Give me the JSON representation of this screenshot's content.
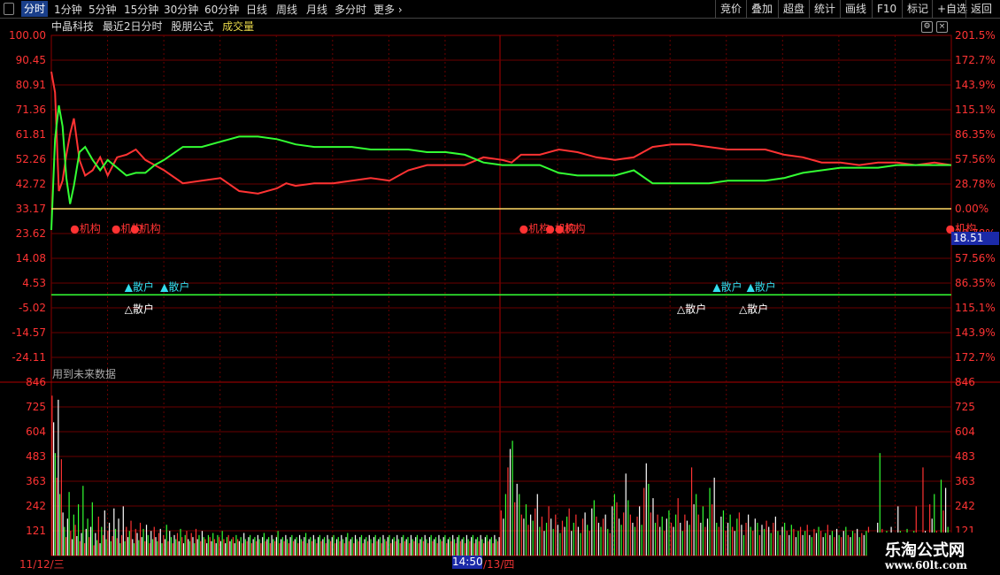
{
  "toolbar": {
    "tabs": [
      "分时",
      "1分钟",
      "5分钟",
      "15分钟",
      "30分钟",
      "60分钟",
      "日线",
      "周线",
      "月线",
      "多分时",
      "更多"
    ],
    "right_buttons": [
      "竞价",
      "叠加",
      "超盘",
      "统计",
      "画线",
      "F10",
      "标记",
      "+自选",
      "返回"
    ]
  },
  "title": {
    "stock_name": "中晶科技",
    "period": "最近2日分时",
    "formula": "股朋公式",
    "indicator": "成交量"
  },
  "colors": {
    "up": "#ff3333",
    "down": "#33ff33",
    "grid": "#8b0000",
    "axis_text": "#ff3333",
    "accent_blue": "#1b2aa8",
    "yellow": "#ffd966",
    "cyan": "#33ddee"
  },
  "chart_data": [
    {
      "type": "line",
      "name": "main_panel",
      "y_left_ticks": [
        "100.00",
        "90.45",
        "80.91",
        "71.36",
        "61.81",
        "52.26",
        "42.72",
        "33.17",
        "23.62",
        "14.08",
        "4.53",
        "-5.02",
        "-14.57",
        "-24.11"
      ],
      "y_right_ticks": [
        "201.5%",
        "172.7%",
        "143.9%",
        "115.1%",
        "86.35%",
        "57.56%",
        "28.78%",
        "0.00%",
        "28.78%",
        "57.56%",
        "86.35%",
        "115.1%",
        "143.9%",
        "172.7%"
      ],
      "ylim": [
        -24.11,
        100.0
      ],
      "x_sessions": [
        "11/12/三",
        "11/13/四"
      ],
      "series": [
        {
          "color": "red",
          "x": [
            0,
            2,
            4,
            6,
            8,
            10,
            12,
            15,
            18,
            22,
            26,
            30,
            35,
            40,
            45,
            50,
            55,
            60,
            70,
            80,
            90,
            100,
            110,
            120,
            125,
            130,
            140,
            150,
            160,
            170,
            180,
            190,
            200,
            210,
            220,
            230,
            240,
            245,
            250,
            260,
            270,
            280,
            290,
            300,
            310,
            320,
            330,
            340,
            350,
            360,
            370,
            380,
            390,
            400,
            410,
            420,
            430,
            440,
            450,
            460,
            470,
            479
          ],
          "y": [
            86,
            78,
            40,
            44,
            54,
            62,
            68,
            52,
            46,
            48,
            53,
            46,
            53,
            54,
            56,
            52,
            50,
            48,
            43,
            44,
            45,
            40,
            39,
            41,
            43,
            42,
            43,
            43,
            44,
            45,
            44,
            48,
            50,
            50,
            50,
            53,
            52,
            51,
            54,
            54,
            56,
            55,
            53,
            52,
            53,
            57,
            58,
            58,
            57,
            56,
            56,
            56,
            54,
            53,
            51,
            51,
            50,
            51,
            51,
            50,
            51,
            50
          ]
        },
        {
          "color": "green",
          "x": [
            0,
            2,
            4,
            6,
            8,
            10,
            12,
            15,
            18,
            22,
            26,
            30,
            35,
            40,
            45,
            50,
            55,
            60,
            70,
            80,
            90,
            100,
            110,
            120,
            125,
            130,
            140,
            150,
            160,
            170,
            180,
            190,
            200,
            210,
            220,
            230,
            240,
            245,
            250,
            260,
            270,
            280,
            290,
            300,
            310,
            320,
            330,
            340,
            350,
            360,
            370,
            380,
            390,
            400,
            410,
            420,
            430,
            440,
            450,
            460,
            470,
            479
          ],
          "y": [
            25,
            60,
            73,
            65,
            45,
            35,
            42,
            55,
            57,
            52,
            48,
            52,
            49,
            46,
            47,
            47,
            50,
            52,
            57,
            57,
            59,
            61,
            61,
            60,
            59,
            58,
            57,
            57,
            57,
            56,
            56,
            56,
            55,
            55,
            54,
            51,
            50,
            50,
            50,
            50,
            47,
            46,
            46,
            46,
            48,
            43,
            43,
            43,
            43,
            44,
            44,
            44,
            45,
            47,
            48,
            49,
            49,
            49,
            50,
            50,
            50,
            50
          ]
        },
        {
          "color": "yellow",
          "x": [
            0,
            479
          ],
          "y": [
            33.17,
            33.17
          ]
        },
        {
          "color": "green",
          "x": [
            0,
            479
          ],
          "y": [
            0.0,
            0.0
          ]
        }
      ],
      "annotations": [
        {
          "text": "机构",
          "x": 10,
          "y": 25.5,
          "color": "red",
          "marker": "●"
        },
        {
          "text": "机构",
          "x": 32,
          "y": 25.5,
          "color": "red",
          "marker": "●"
        },
        {
          "text": "机构",
          "x": 42,
          "y": 25.5,
          "color": "red",
          "marker": "●"
        },
        {
          "text": "机构",
          "x": 249,
          "y": 25.5,
          "color": "red",
          "marker": "●"
        },
        {
          "text": "机构",
          "x": 263,
          "y": 25.5,
          "color": "red",
          "marker": "●"
        },
        {
          "text": "机构",
          "x": 268,
          "y": 25.5,
          "color": "red",
          "marker": "●"
        },
        {
          "text": "机构",
          "x": 476,
          "y": 25.5,
          "color": "red",
          "marker": "●"
        },
        {
          "text": "散户",
          "x": 39,
          "y": 3,
          "color": "cyan",
          "marker": "▲"
        },
        {
          "text": "散户",
          "x": 58,
          "y": 3,
          "color": "cyan",
          "marker": "▲"
        },
        {
          "text": "散户",
          "x": 352,
          "y": 3,
          "color": "cyan",
          "marker": "▲"
        },
        {
          "text": "散户",
          "x": 370,
          "y": 3,
          "color": "cyan",
          "marker": "▲"
        },
        {
          "text": "散户",
          "x": 39,
          "y": -5.5,
          "color": "white",
          "marker": "△"
        },
        {
          "text": "散户",
          "x": 333,
          "y": -5.5,
          "color": "white",
          "marker": "△"
        },
        {
          "text": "散户",
          "x": 366,
          "y": -5.5,
          "color": "white",
          "marker": "△"
        }
      ],
      "price_tag": "18.51"
    },
    {
      "type": "bar",
      "name": "volume_panel",
      "y_ticks": [
        "846",
        "725",
        "604",
        "483",
        "363",
        "242",
        "121"
      ],
      "ylim": [
        0,
        846
      ],
      "notice": "用到未来数据",
      "colors_cycle": [
        "red",
        "green",
        "white"
      ],
      "values": [
        780,
        650,
        500,
        380,
        760,
        300,
        470,
        210,
        140,
        90,
        180,
        310,
        120,
        80,
        200,
        150,
        95,
        250,
        70,
        110,
        340,
        60,
        130,
        180,
        90,
        140,
        260,
        50,
        110,
        75,
        190,
        60,
        140,
        100,
        220,
        80,
        120,
        160,
        70,
        95,
        230,
        130,
        85,
        180,
        60,
        100,
        240,
        70,
        140,
        90,
        120,
        170,
        80,
        60,
        130,
        110,
        75,
        160,
        90,
        130,
        70,
        150,
        100,
        60,
        120,
        80,
        140,
        90,
        70,
        110,
        130,
        60,
        100,
        80,
        150,
        70,
        120,
        90,
        60,
        100,
        80,
        110,
        70,
        130,
        90,
        60,
        100,
        120,
        80,
        70,
        110,
        90,
        60,
        130,
        80,
        100,
        70,
        120,
        90,
        80,
        60,
        100,
        90,
        70,
        110,
        80,
        60,
        100,
        90,
        70,
        120,
        80,
        60,
        90,
        100,
        70,
        80,
        90,
        60,
        100,
        80,
        70,
        90,
        60,
        110,
        80,
        70,
        90,
        100,
        60,
        80,
        90,
        70,
        100,
        80,
        60,
        90,
        110,
        70,
        80,
        90,
        60,
        100,
        80,
        70,
        90,
        120,
        60,
        80,
        90,
        70,
        100,
        80,
        60,
        90,
        100,
        70,
        80,
        90,
        60,
        100,
        80,
        70,
        90,
        110,
        60,
        80,
        90,
        70,
        100,
        80,
        60,
        90,
        100,
        70,
        80,
        90,
        60,
        100,
        80,
        70,
        90,
        100,
        60,
        80,
        90,
        70,
        100,
        80,
        60,
        90,
        110,
        70,
        80,
        90,
        60,
        100,
        80,
        70,
        90,
        100,
        60,
        80,
        90,
        70,
        100,
        80,
        60,
        90,
        100,
        70,
        80,
        90,
        60,
        100,
        80,
        70,
        90,
        100,
        60,
        80,
        90,
        70,
        100,
        80,
        60,
        90,
        100,
        70,
        80,
        90,
        60,
        100,
        80,
        70,
        90,
        100,
        60,
        80,
        90,
        70,
        100,
        80,
        60,
        90,
        100,
        70,
        80,
        90,
        60,
        100,
        80,
        70,
        90,
        100,
        60,
        80,
        90,
        70,
        100,
        80,
        60,
        90,
        100,
        70,
        80,
        90,
        60,
        100,
        80,
        70,
        90,
        100,
        60,
        80,
        90,
        70,
        100,
        80,
        60,
        90,
        100,
        70,
        80,
        90,
        60,
        100,
        80,
        70,
        90
      ],
      "session2_values": [
        220,
        180,
        300,
        430,
        520,
        560,
        260,
        350,
        300,
        200,
        180,
        250,
        150,
        200,
        170,
        230,
        300,
        140,
        190,
        120,
        160,
        240,
        180,
        130,
        200,
        150,
        110,
        170,
        140,
        190,
        230,
        120,
        160,
        200,
        140,
        110,
        180,
        210,
        150,
        120,
        230,
        270,
        190,
        160,
        140,
        180,
        200,
        130,
        110,
        240,
        300,
        260,
        180,
        150,
        210,
        400,
        270,
        200,
        160,
        140,
        190,
        240,
        150,
        330,
        450,
        350,
        210,
        280,
        160,
        200,
        140,
        190,
        120,
        180,
        220,
        160,
        140,
        200,
        280,
        160,
        120,
        200,
        170,
        150,
        430,
        250,
        300,
        200,
        160,
        240,
        140,
        180,
        330,
        250,
        380,
        160,
        140,
        190,
        220,
        120,
        160,
        200,
        140,
        120,
        180,
        210,
        150,
        100,
        160,
        200,
        140,
        120,
        180,
        160,
        100,
        150,
        130,
        170,
        140,
        110,
        160,
        190,
        120,
        100,
        140,
        160,
        120,
        100,
        150,
        130,
        90,
        120,
        140,
        100,
        120,
        150,
        100,
        90,
        130,
        110,
        140,
        120,
        90,
        110,
        150,
        100,
        120,
        90,
        130,
        100,
        90,
        120,
        140,
        100,
        90,
        120,
        110,
        130,
        90,
        110,
        100,
        120,
        140,
        100,
        90,
        110,
        160,
        500,
        130,
        100,
        120,
        90,
        140,
        110,
        100,
        240,
        120,
        90,
        110,
        130,
        100,
        90,
        120,
        240,
        110,
        100,
        430,
        120,
        90,
        250,
        180,
        300,
        120,
        90,
        370,
        220,
        330,
        140,
        90
      ]
    }
  ],
  "axis_labels": {
    "date_left": "11/12/三",
    "cursor_time": "14:50",
    "date_right": "/13/四"
  },
  "watermark": {
    "title": "乐淘公式网",
    "url": "www.60lt.com"
  }
}
